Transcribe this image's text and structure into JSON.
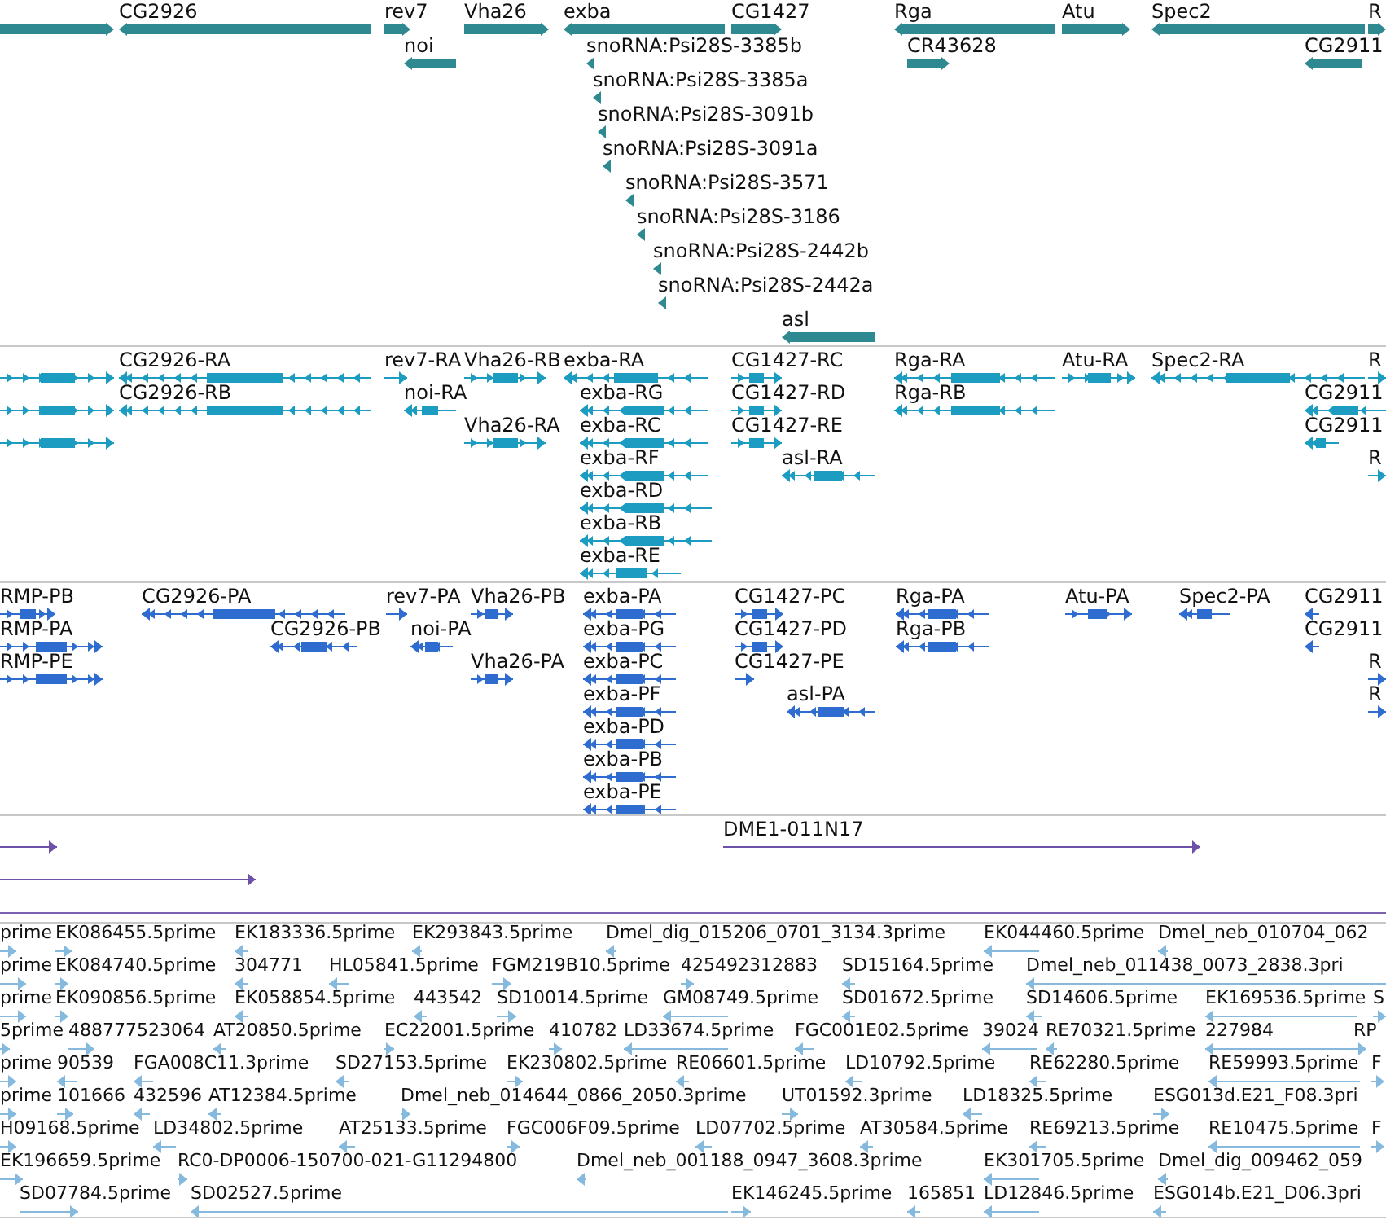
{
  "tracks": [
    {
      "kind": "gene",
      "features": [
        {
          "reverse": false
        },
        {
          "label": "CG2926",
          "reverse": true
        },
        {
          "label": "rev7",
          "reverse": false
        },
        {
          "label": "Vha26",
          "reverse": false
        },
        {
          "label": "exba",
          "reverse": true
        },
        {
          "label": "CG1427",
          "reverse": false
        },
        {
          "label": "Rga",
          "reverse": true
        },
        {
          "label": "Atu",
          "reverse": false
        },
        {
          "label": "Spec2",
          "reverse": true
        },
        {
          "label": "R",
          "reverse": false
        },
        {
          "label": "noi",
          "reverse": true
        },
        {
          "label": "snoRNA:Psi28S-3385b",
          "reverse": true
        },
        {
          "label": "CR43628",
          "reverse": false
        },
        {
          "label": "CG2911",
          "reverse": true
        },
        {
          "label": "snoRNA:Psi28S-3385a",
          "reverse": true
        },
        {
          "label": "snoRNA:Psi28S-3091b",
          "reverse": true
        },
        {
          "label": "snoRNA:Psi28S-3091a",
          "reverse": true
        },
        {
          "label": "snoRNA:Psi28S-3571",
          "reverse": true
        },
        {
          "label": "snoRNA:Psi28S-3186",
          "reverse": true
        },
        {
          "label": "snoRNA:Psi28S-2442b",
          "reverse": true
        },
        {
          "label": "snoRNA:Psi28S-2442a",
          "reverse": true
        },
        {
          "label": "asl",
          "reverse": true
        }
      ]
    },
    {
      "kind": "transcript",
      "features": [
        {
          "reverse": false
        },
        {
          "label": "CG2926-RA",
          "reverse": true
        },
        {
          "label": "rev7-RA",
          "reverse": false
        },
        {
          "label": "Vha26-RB",
          "reverse": false
        },
        {
          "label": "exba-RA",
          "reverse": true
        },
        {
          "label": "CG1427-RC",
          "reverse": false
        },
        {
          "label": "Rga-RA",
          "reverse": true
        },
        {
          "label": "Atu-RA",
          "reverse": false
        },
        {
          "label": "Spec2-RA",
          "reverse": true
        },
        {
          "label": "R",
          "reverse": false
        },
        {
          "reverse": false
        },
        {
          "label": "CG2926-RB",
          "reverse": true
        },
        {
          "label": "noi-RA",
          "reverse": true
        },
        {
          "label": "exba-RG",
          "reverse": true
        },
        {
          "label": "CG1427-RD",
          "reverse": false
        },
        {
          "label": "Rga-RB",
          "reverse": true
        },
        {
          "label": "CG2911",
          "reverse": true
        },
        {
          "reverse": false
        },
        {
          "label": "Vha26-RA",
          "reverse": false
        },
        {
          "label": "exba-RC",
          "reverse": true
        },
        {
          "label": "CG1427-RE",
          "reverse": false
        },
        {
          "label": "CG2911",
          "reverse": true
        },
        {
          "label": "exba-RF",
          "reverse": true
        },
        {
          "label": "asl-RA",
          "reverse": true
        },
        {
          "label": "R",
          "reverse": false
        },
        {
          "label": "exba-RD",
          "reverse": true
        },
        {
          "label": "exba-RB",
          "reverse": true
        },
        {
          "label": "exba-RE",
          "reverse": true
        }
      ]
    },
    {
      "kind": "protein",
      "features": [
        {
          "label": "RMP-PB",
          "reverse": false
        },
        {
          "label": "CG2926-PA",
          "reverse": true
        },
        {
          "label": "rev7-PA",
          "reverse": false
        },
        {
          "label": "Vha26-PB",
          "reverse": false
        },
        {
          "label": "exba-PA",
          "reverse": true
        },
        {
          "label": "CG1427-PC",
          "reverse": false
        },
        {
          "label": "Rga-PA",
          "reverse": true
        },
        {
          "label": "Atu-PA",
          "reverse": false
        },
        {
          "label": "Spec2-PA",
          "reverse": true
        },
        {
          "label": "CG2911",
          "reverse": true
        },
        {
          "label": "RMP-PA",
          "reverse": false
        },
        {
          "label": "CG2926-PB",
          "reverse": true
        },
        {
          "label": "noi-PA",
          "reverse": true
        },
        {
          "label": "exba-PG",
          "reverse": true
        },
        {
          "label": "CG1427-PD",
          "reverse": false
        },
        {
          "label": "Rga-PB",
          "reverse": true
        },
        {
          "label": "CG2911",
          "reverse": true
        },
        {
          "label": "RMP-PE",
          "reverse": false
        },
        {
          "label": "Vha26-PA",
          "reverse": false
        },
        {
          "label": "exba-PC",
          "reverse": true
        },
        {
          "label": "CG1427-PE",
          "reverse": false
        },
        {
          "label": "R",
          "reverse": false
        },
        {
          "label": "exba-PF",
          "reverse": true
        },
        {
          "label": "asl-PA",
          "reverse": true
        },
        {
          "label": "R",
          "reverse": false
        },
        {
          "label": "exba-PD",
          "reverse": true
        },
        {
          "label": "exba-PB",
          "reverse": true
        },
        {
          "label": "exba-PE",
          "reverse": true
        }
      ]
    },
    {
      "kind": "clone",
      "features": [
        {
          "reverse": false
        },
        {
          "label": "DME1-011N17",
          "reverse": false
        },
        {
          "reverse": false
        }
      ]
    },
    {
      "kind": "est",
      "features": [
        {
          "label": "prime",
          "reverse": false
        },
        {
          "label": "EK086455.5prime",
          "reverse": false
        },
        {
          "label": "EK183336.5prime",
          "reverse": true
        },
        {
          "label": "EK293843.5prime",
          "reverse": true
        },
        {
          "label": "Dmel_dig_015206_0701_3134.3prime",
          "reverse": true
        },
        {
          "label": "EK044460.5prime",
          "reverse": true
        },
        {
          "label": "Dmel_neb_010704_062",
          "reverse": true
        },
        {
          "label": "prime",
          "reverse": false
        },
        {
          "label": "EK084740.5prime",
          "reverse": false
        },
        {
          "label": "304771",
          "reverse": true
        },
        {
          "label": "HL05841.5prime",
          "reverse": true
        },
        {
          "label": "FGM219B10.5prime",
          "reverse": false
        },
        {
          "label": "425492312883",
          "reverse": false
        },
        {
          "label": "SD15164.5prime",
          "reverse": true
        },
        {
          "label": "Dmel_neb_011438_0073_2838.3pri",
          "reverse": true
        },
        {
          "label": "prime",
          "reverse": false
        },
        {
          "label": "EK090856.5prime",
          "reverse": false
        },
        {
          "label": "EK058854.5prime",
          "reverse": true
        },
        {
          "label": "443542",
          "reverse": true
        },
        {
          "label": "SD10014.5prime",
          "reverse": false
        },
        {
          "label": "GM08749.5prime",
          "reverse": true
        },
        {
          "label": "SD01672.5prime",
          "reverse": true
        },
        {
          "label": "SD14606.5prime",
          "reverse": true
        },
        {
          "label": "EK169536.5prime",
          "reverse": true
        },
        {
          "label": "S",
          "reverse": false
        },
        {
          "label": "5prime",
          "reverse": false
        },
        {
          "label": "488777523064",
          "reverse": false
        },
        {
          "label": "AT20850.5prime",
          "reverse": true
        },
        {
          "label": "EC22001.5prime",
          "reverse": false
        },
        {
          "label": "410782",
          "reverse": false
        },
        {
          "label": "LD33674.5prime",
          "reverse": true
        },
        {
          "label": "FGC001E02.5prime",
          "reverse": true
        },
        {
          "label": "39024",
          "reverse": true
        },
        {
          "label": "RE70321.5prime",
          "reverse": true
        },
        {
          "label": "227984",
          "reverse": true
        },
        {
          "label": "RP",
          "reverse": false
        },
        {
          "label": "prime",
          "reverse": false
        },
        {
          "label": "90539",
          "reverse": true
        },
        {
          "label": "FGA008C11.3prime",
          "reverse": true
        },
        {
          "label": "SD27153.5prime",
          "reverse": true
        },
        {
          "label": "EK230802.5prime",
          "reverse": false
        },
        {
          "label": "RE06601.5prime",
          "reverse": true
        },
        {
          "label": "LD10792.5prime",
          "reverse": true
        },
        {
          "label": "RE62280.5prime",
          "reverse": true
        },
        {
          "label": "RE59993.5prime",
          "reverse": true
        },
        {
          "label": "F",
          "reverse": false
        },
        {
          "label": "prime",
          "reverse": false
        },
        {
          "label": "101666",
          "reverse": false
        },
        {
          "label": "432596",
          "reverse": true
        },
        {
          "label": "AT12384.5prime",
          "reverse": true
        },
        {
          "label": "Dmel_neb_014644_0866_2050.3prime",
          "reverse": false
        },
        {
          "label": "UT01592.3prime",
          "reverse": false
        },
        {
          "label": "LD18325.5prime",
          "reverse": true
        },
        {
          "label": "ESG013d.E21_F08.3pri",
          "reverse": false
        },
        {
          "label": "H09168.5prime",
          "reverse": false
        },
        {
          "label": "LD34802.5prime",
          "reverse": true
        },
        {
          "label": "AT25133.5prime",
          "reverse": true
        },
        {
          "label": "FGC006F09.5prime",
          "reverse": false
        },
        {
          "label": "LD07702.5prime",
          "reverse": true
        },
        {
          "label": "AT30584.5prime",
          "reverse": true
        },
        {
          "label": "RE69213.5prime",
          "reverse": true
        },
        {
          "label": "RE10475.5prime",
          "reverse": true
        },
        {
          "label": "F",
          "reverse": false
        },
        {
          "label": "EK196659.5prime",
          "reverse": false
        },
        {
          "label": "RC0-DP0006-150700-021-G11294800",
          "reverse": false
        },
        {
          "label": "Dmel_neb_001188_0947_3608.3prime",
          "reverse": true
        },
        {
          "label": "EK301705.5prime",
          "reverse": true
        },
        {
          "label": "Dmel_dig_009462_059",
          "reverse": true
        },
        {
          "label": "SD07784.5prime",
          "reverse": false
        },
        {
          "label": "SD02527.5prime",
          "reverse": true
        },
        {
          "label": "EK146245.5prime",
          "reverse": false
        },
        {
          "label": "165851",
          "reverse": true
        },
        {
          "label": "LD12846.5prime",
          "reverse": true
        },
        {
          "label": "ESG014b.E21_D06.3pri",
          "reverse": true
        }
      ]
    }
  ]
}
